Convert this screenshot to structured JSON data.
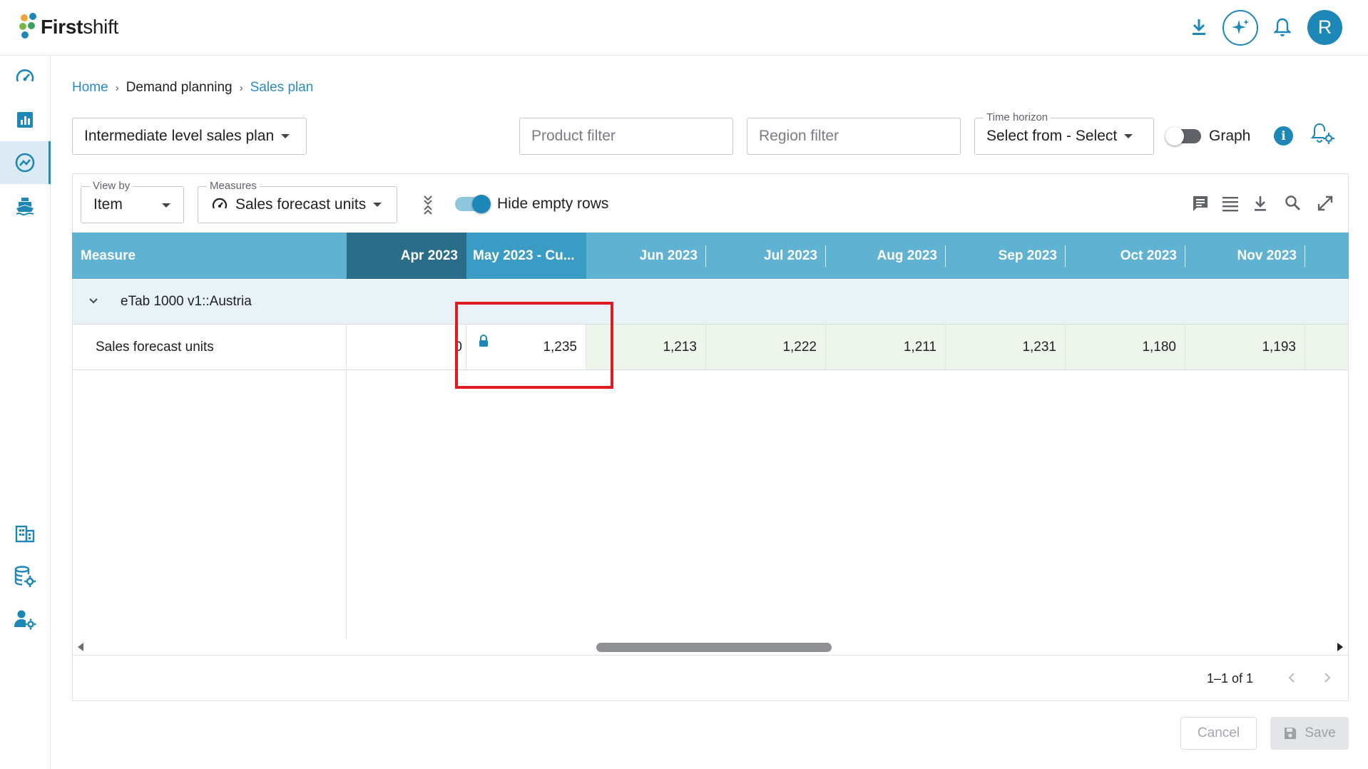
{
  "app": {
    "logo_bold": "First",
    "logo_rest": "shift"
  },
  "topbar": {
    "icons": [
      "download-icon",
      "ai-sparkle-icon",
      "bell-icon"
    ],
    "avatar_initial": "R",
    "avatar_color": "#1d87b8"
  },
  "sidebar": {
    "top_items": [
      "dashboard-icon",
      "reports-icon",
      "demand-planning-icon",
      "supply-ship-icon"
    ],
    "active": "demand-planning-icon",
    "bottom_items": [
      "organization-icon",
      "data-settings-icon",
      "user-settings-icon"
    ]
  },
  "breadcrumb": [
    "Home",
    "Demand planning",
    "Sales plan"
  ],
  "controls": {
    "plan_select": "Intermediate level sales plan",
    "product_filter_placeholder": "Product filter",
    "region_filter_placeholder": "Region filter",
    "time_horizon_label": "Time horizon",
    "time_horizon_value": "Select from - Select",
    "graph_label": "Graph",
    "graph_on": false
  },
  "grid_toolbar": {
    "view_by_label": "View by",
    "view_by_value": "Item",
    "measures_label": "Measures",
    "measures_value": "Sales forecast units",
    "hide_empty_label": "Hide empty rows",
    "hide_empty_on": true,
    "right_icons": [
      "comment-icon",
      "columns-icon",
      "export-icon",
      "search-icon",
      "fullscreen-icon"
    ]
  },
  "grid": {
    "measure_header": "Measure",
    "columns": [
      "Apr 2023",
      "May 2023 - Cu...",
      "Jun 2023",
      "Jul 2023",
      "Aug 2023",
      "Sep 2023",
      "Oct 2023",
      "Nov 2023"
    ],
    "group_label": "eTab 1000 v1::Austria",
    "row_label": "Sales forecast units",
    "values": [
      "0",
      "1,235",
      "1,213",
      "1,222",
      "1,211",
      "1,231",
      "1,180",
      "1,193"
    ],
    "locked_column": "May 2023 - Cu...",
    "header_color": "#5fb2d2",
    "frozen_header_color": "#2a6d88",
    "current_header_color": "#3a9cc4"
  },
  "pager": {
    "text": "1–1 of 1"
  },
  "footer": {
    "cancel": "Cancel",
    "save": "Save"
  }
}
